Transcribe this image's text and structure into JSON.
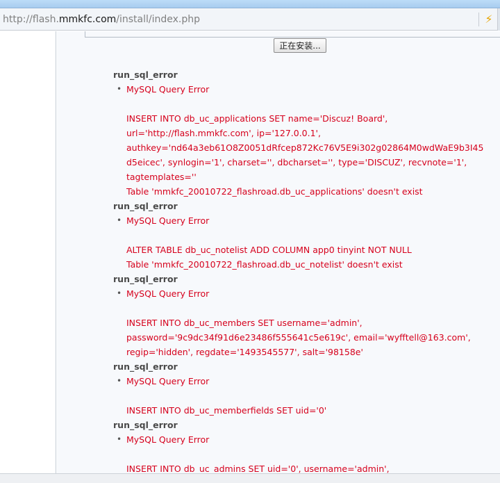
{
  "browser": {
    "url_prefix": "http://flash.",
    "url_host": "mmkfc.com",
    "url_path": "/install/index.php",
    "bolt_icon": "lightning-icon"
  },
  "install_button_label": "正在安装...",
  "errors": [
    {
      "title": "run_sql_error",
      "item": "MySQL Query Error",
      "lines": [
        "INSERT INTO db_uc_applications SET name='Discuz! Board',",
        "url='http://flash.mmkfc.com', ip='127.0.0.1',",
        "authkey='nd64a3eb61O8Z0051dRfcep872Kc76V5E9i302g02864M0wdWaE9b3I45",
        "d5eicec', synlogin='1', charset='', dbcharset='', type='DISCUZ', recvnote='1',",
        "tagtemplates=''",
        "Table 'mmkfc_20010722_flashroad.db_uc_applications' doesn't exist"
      ]
    },
    {
      "title": "run_sql_error",
      "item": "MySQL Query Error",
      "lines": [
        "ALTER TABLE db_uc_notelist ADD COLUMN app0 tinyint NOT NULL",
        "Table 'mmkfc_20010722_flashroad.db_uc_notelist' doesn't exist"
      ]
    },
    {
      "title": "run_sql_error",
      "item": "MySQL Query Error",
      "lines": [
        "INSERT INTO db_uc_members SET username='admin',",
        "password='9c9dc34f91d6e23486f555641c5e619c', email='wyfftell@163.com',",
        "regip='hidden', regdate='1493545577', salt='98158e'"
      ]
    },
    {
      "title": "run_sql_error",
      "item": "MySQL Query Error",
      "lines": [
        "INSERT INTO db_uc_memberfields SET uid='0'"
      ]
    },
    {
      "title": "run_sql_error",
      "item": "MySQL Query Error",
      "lines": [
        "INSERT INTO db_uc_admins SET uid='0', username='admin',"
      ]
    }
  ]
}
